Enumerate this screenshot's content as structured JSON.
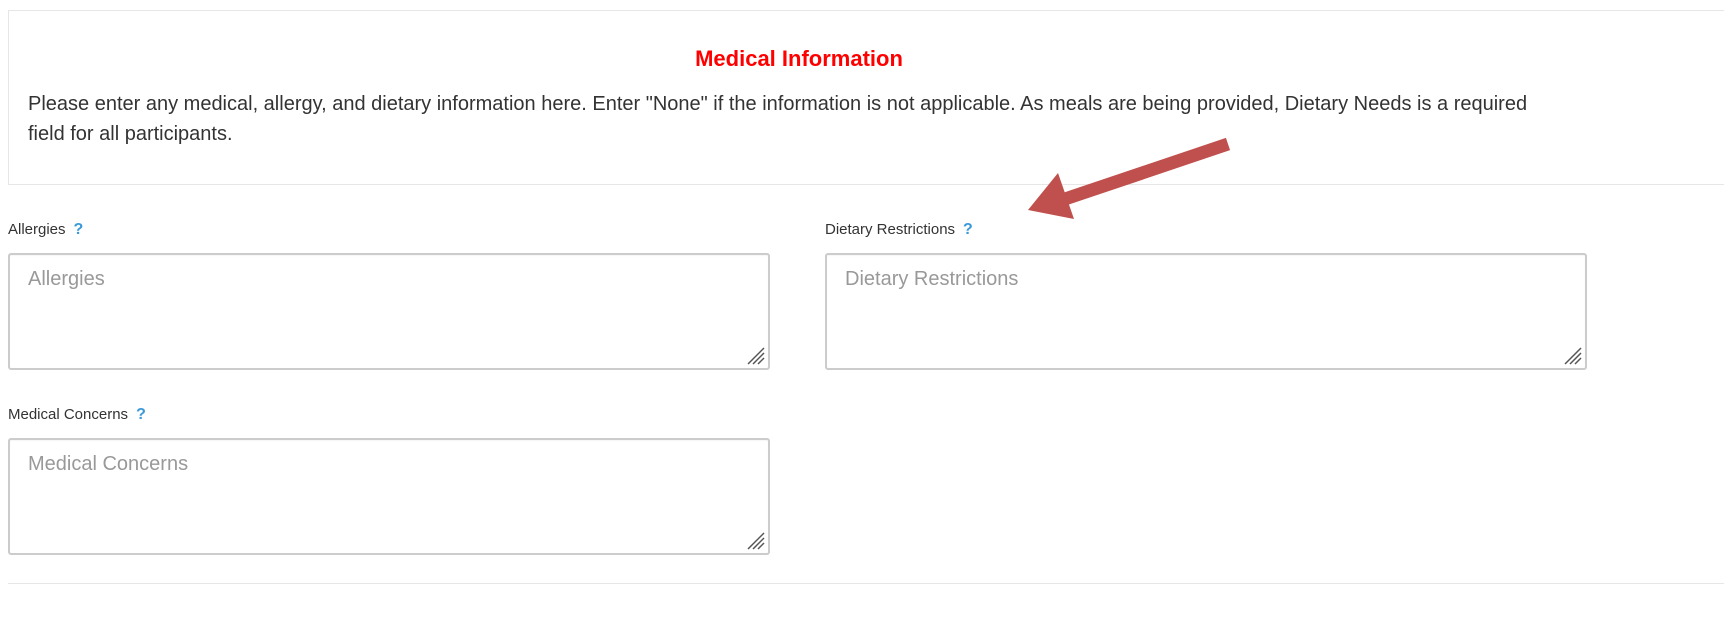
{
  "section": {
    "title": "Medical Information",
    "description": "Please enter any medical, allergy, and dietary information here. Enter \"None\" if the information is not applicable. As meals are being provided, Dietary Needs is a required field for all participants."
  },
  "fields": {
    "allergies": {
      "label": "Allergies",
      "placeholder": "Allergies",
      "help": "?"
    },
    "dietary": {
      "label": "Dietary Restrictions",
      "placeholder": "Dietary Restrictions",
      "help": "?"
    },
    "medical": {
      "label": "Medical Concerns",
      "placeholder": "Medical Concerns",
      "help": "?"
    }
  },
  "colors": {
    "title": "#ff0000",
    "help_icon": "#3a9ad9",
    "annotation_arrow": "#c0504d"
  },
  "icons": {
    "help": "question-mark-icon",
    "resize": "resize-grip-icon",
    "annotation": "red-arrow-annotation"
  }
}
